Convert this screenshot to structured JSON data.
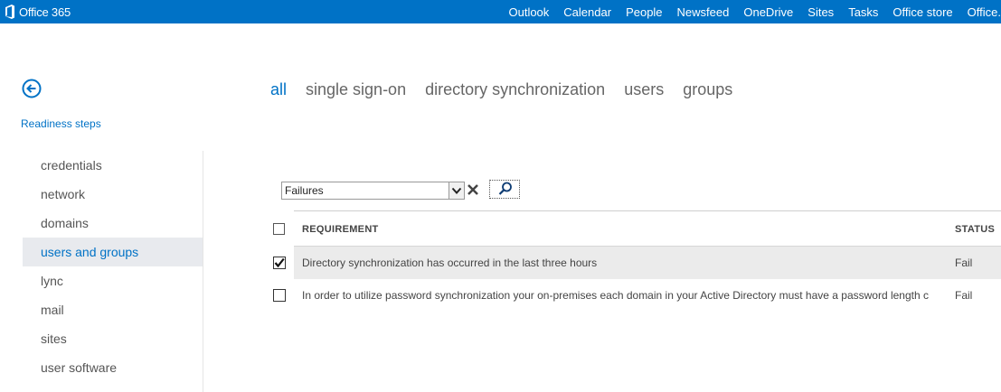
{
  "topbar": {
    "brand": "Office 365",
    "nav": [
      "Outlook",
      "Calendar",
      "People",
      "Newsfeed",
      "OneDrive",
      "Sites",
      "Tasks",
      "Office store",
      "Office."
    ]
  },
  "back": {
    "label": "Readiness steps"
  },
  "leftnav": {
    "items": [
      "credentials",
      "network",
      "domains",
      "users and groups",
      "lync",
      "mail",
      "sites",
      "user software"
    ],
    "selected": "users and groups"
  },
  "pivots": {
    "items": [
      "all",
      "single sign-on",
      "directory synchronization",
      "users",
      "groups"
    ],
    "active": "all"
  },
  "filter": {
    "value": "Failures"
  },
  "table": {
    "columns": {
      "requirement": "REQUIREMENT",
      "status": "STATUS"
    },
    "rows": [
      {
        "requirement": "Directory synchronization has occurred in the last three hours",
        "status": "Fail",
        "checked": true
      },
      {
        "requirement": "In order to utilize password synchronization your on-premises each domain in your Active Directory must have a password length c",
        "status": "Fail",
        "checked": false
      }
    ]
  },
  "colors": {
    "accent": "#0072c6",
    "selected_bg": "#e8eaee"
  },
  "icons": {
    "brand": "office-logo-icon",
    "back": "back-arrow-icon",
    "clear": "clear-x-icon",
    "search": "search-icon",
    "dropdown": "chevron-down-icon",
    "check": "checkmark-icon"
  }
}
